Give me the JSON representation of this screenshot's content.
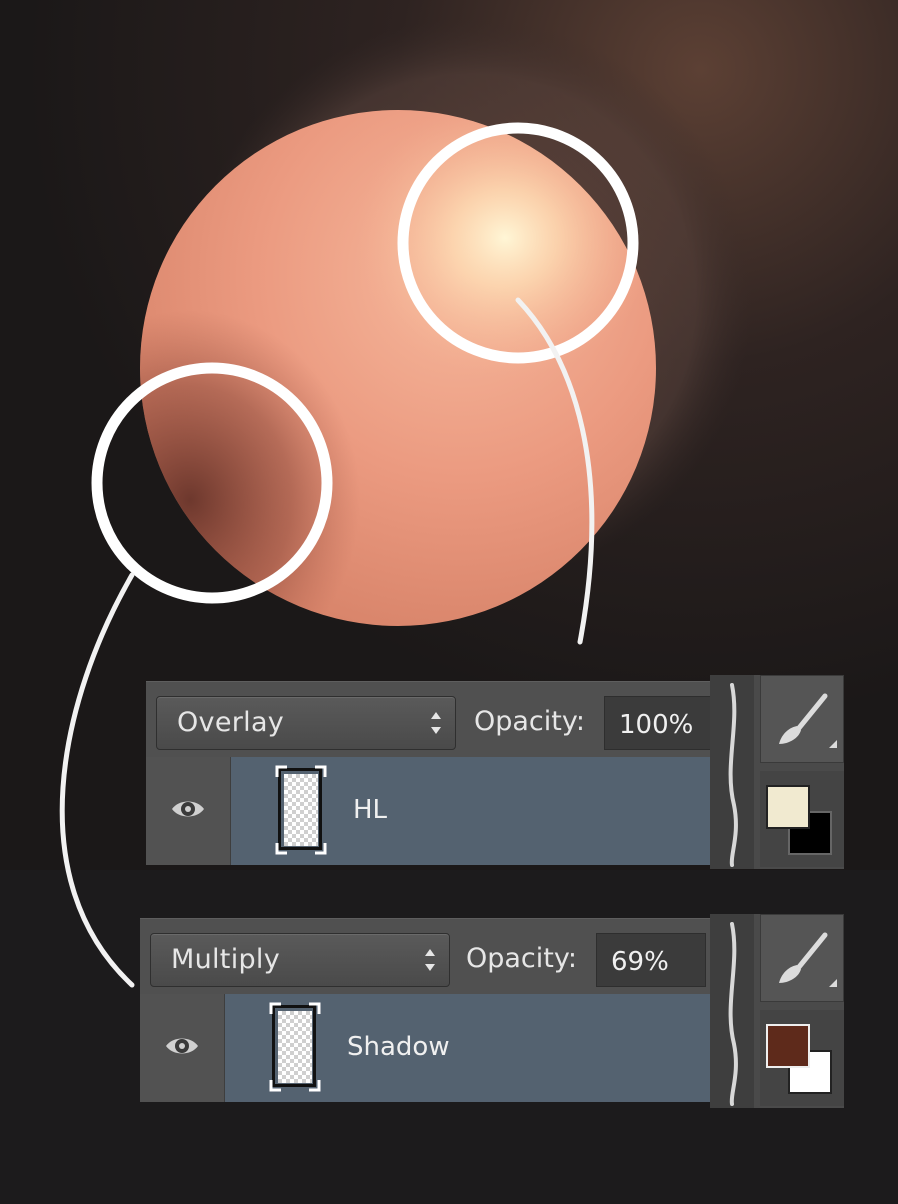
{
  "panels": [
    {
      "blend_mode": "Overlay",
      "opacity_label": "Opacity:",
      "opacity_value": "100%",
      "layer_name": "HL",
      "foreground_color": "#f1ead0",
      "background_color": "#000000"
    },
    {
      "blend_mode": "Multiply",
      "opacity_label": "Opacity:",
      "opacity_value": "69%",
      "layer_name": "Shadow",
      "foreground_color": "#5e2a1b",
      "background_color": "#ffffff"
    }
  ],
  "icons": {
    "visibility": "eye-icon",
    "brush": "brush-icon",
    "blend_dropdown": "chevron-updown-icon"
  },
  "colors": {
    "sphere": "#eb9a80",
    "highlight": "#fff0c8",
    "shadow": "#7a3a2e",
    "annotation": "#ffffff",
    "layer_selected": "#546270"
  }
}
